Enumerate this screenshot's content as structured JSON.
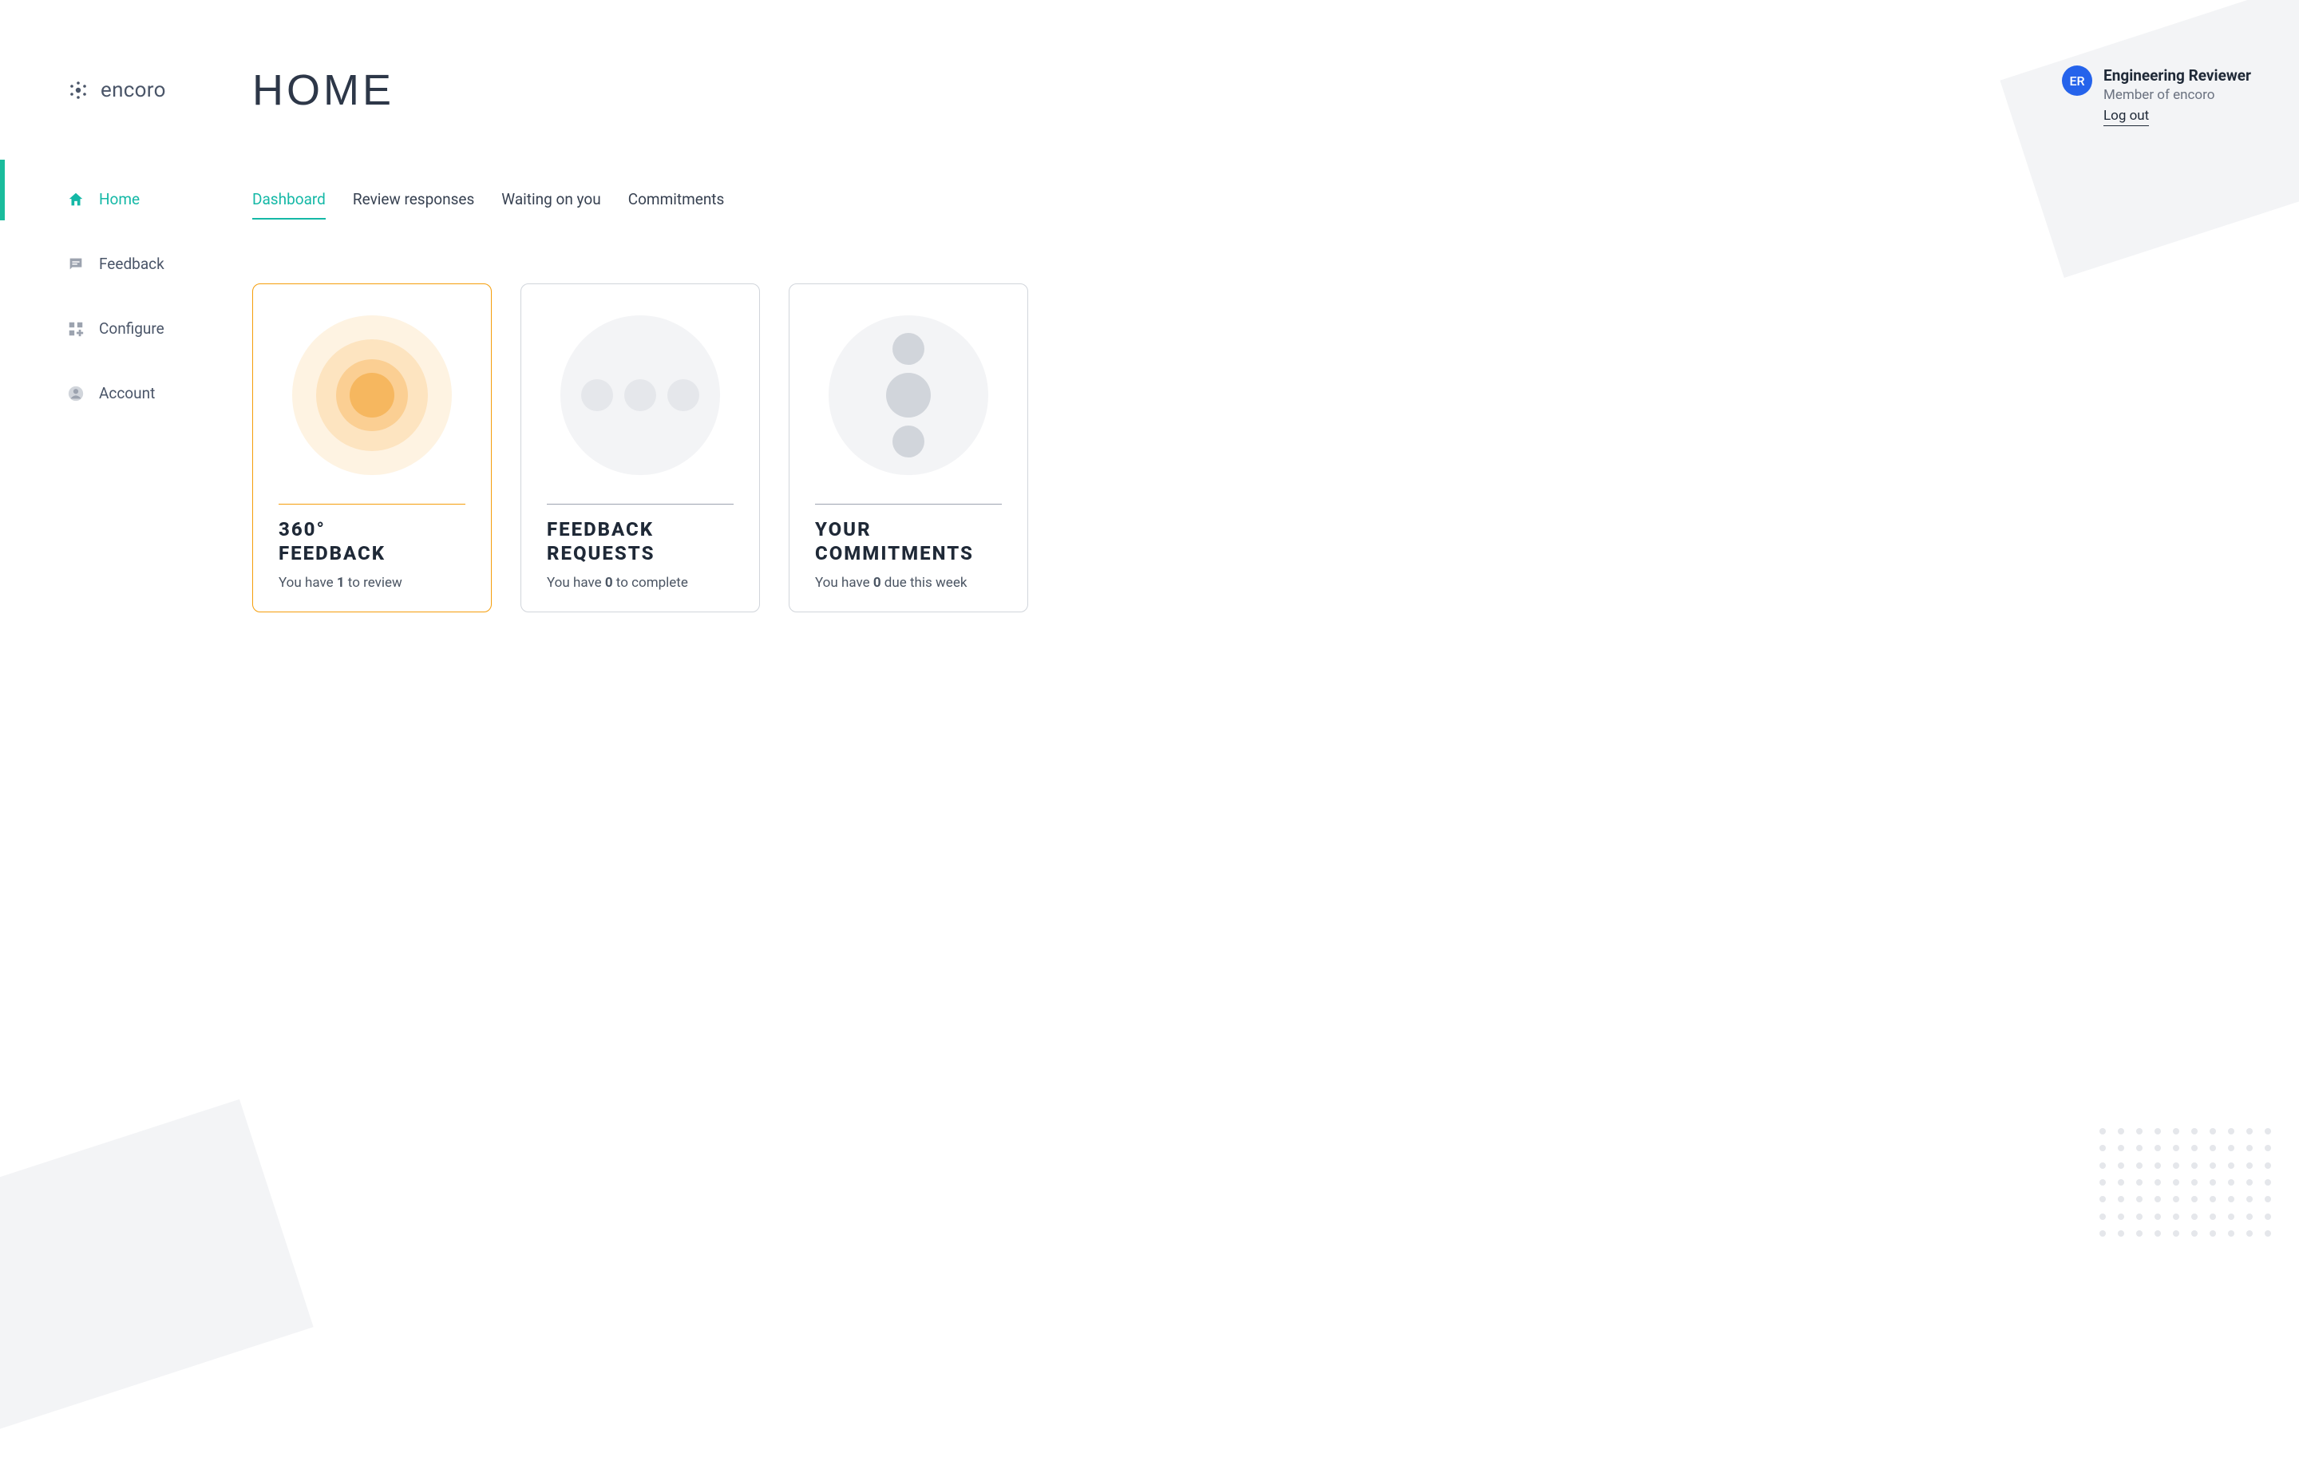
{
  "brand": {
    "name": "encoro"
  },
  "page_title": "HOME",
  "user": {
    "initials": "ER",
    "name": "Engineering Reviewer",
    "subtitle": "Member of encoro",
    "logout_label": "Log out"
  },
  "sidebar": {
    "items": [
      {
        "label": "Home",
        "active": true
      },
      {
        "label": "Feedback",
        "active": false
      },
      {
        "label": "Configure",
        "active": false
      },
      {
        "label": "Account",
        "active": false
      }
    ]
  },
  "tabs": [
    {
      "label": "Dashboard",
      "active": true
    },
    {
      "label": "Review responses",
      "active": false
    },
    {
      "label": "Waiting on you",
      "active": false
    },
    {
      "label": "Commitments",
      "active": false
    }
  ],
  "cards": [
    {
      "title": "360°\nFEEDBACK",
      "sub_prefix": "You have ",
      "count": "1",
      "sub_suffix": " to review",
      "highlight": true
    },
    {
      "title": "FEEDBACK\nREQUESTS",
      "sub_prefix": "You have ",
      "count": "0",
      "sub_suffix": " to complete",
      "highlight": false
    },
    {
      "title": "YOUR\nCOMMITMENTS",
      "sub_prefix": "You have ",
      "count": "0",
      "sub_suffix": " due this week",
      "highlight": false
    }
  ]
}
